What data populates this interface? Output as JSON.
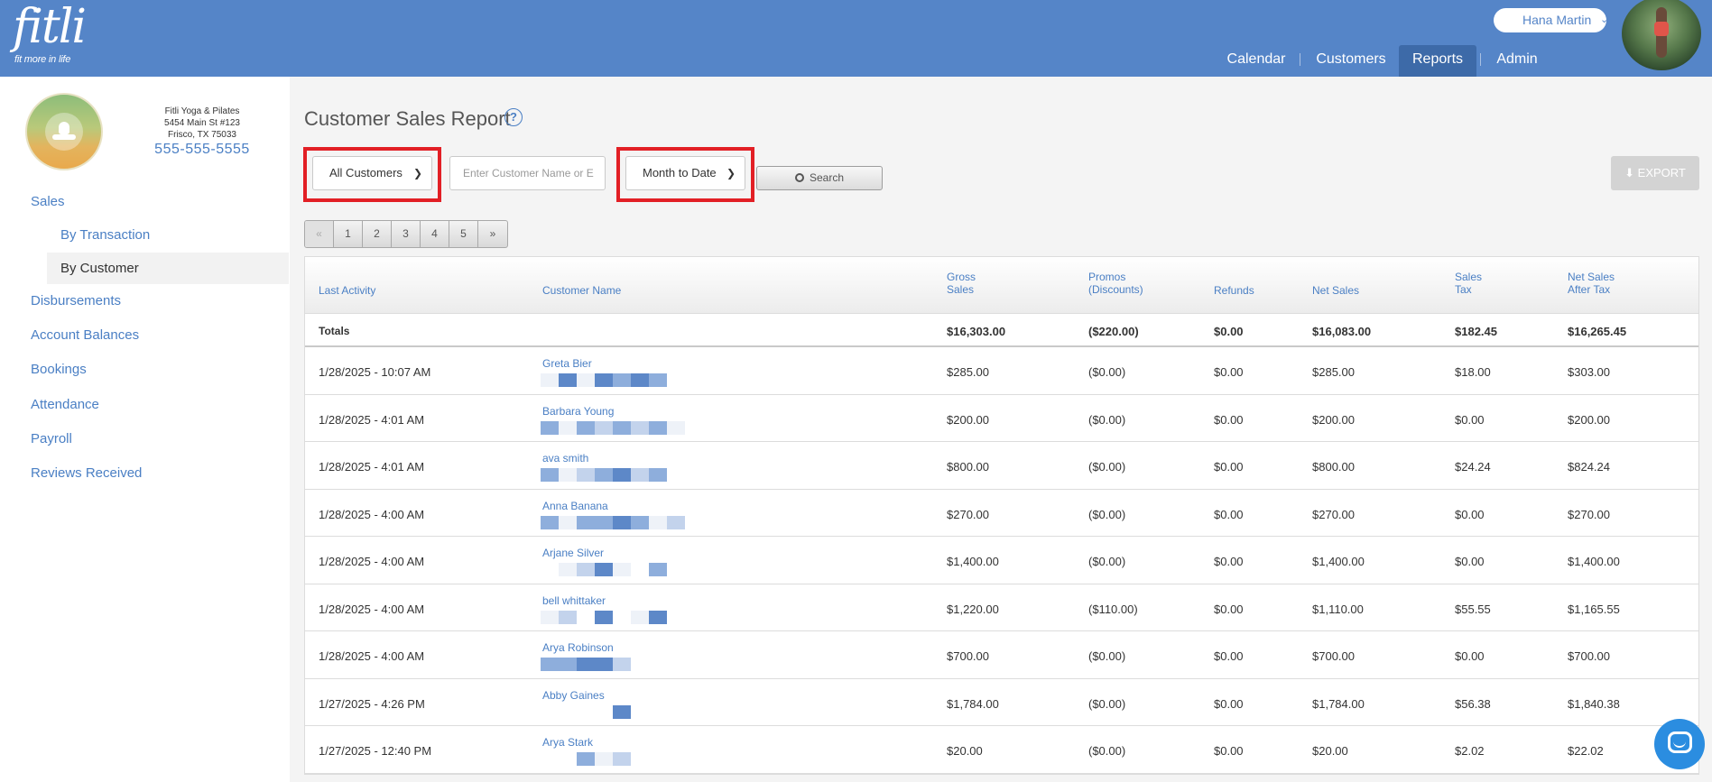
{
  "brand": {
    "name": "fitli",
    "tagline": "fit more in life"
  },
  "user": {
    "name": "Hana Martin"
  },
  "nav": {
    "calendar": "Calendar",
    "customers": "Customers",
    "reports": "Reports",
    "admin": "Admin"
  },
  "studio": {
    "name": "Fitli Yoga & Pilates",
    "address1": "5454 Main St #123",
    "address2": "Frisco, TX 75033",
    "phone": "555-555-5555"
  },
  "sidebar": {
    "sales": "Sales",
    "by_transaction": "By Transaction",
    "by_customer": "By Customer",
    "disbursements": "Disbursements",
    "account_balances": "Account Balances",
    "bookings": "Bookings",
    "attendance": "Attendance",
    "payroll": "Payroll",
    "reviews": "Reviews Received"
  },
  "report": {
    "title": "Customer Sales Report",
    "customer_filter": "All Customers",
    "search_placeholder": "Enter Customer Name or E",
    "date_filter": "Month to Date",
    "search_label": "Search",
    "export_label": "EXPORT",
    "pages": [
      "«",
      "1",
      "2",
      "3",
      "4",
      "5",
      "»"
    ]
  },
  "table": {
    "headers": {
      "last_activity": "Last Activity",
      "customer_name": "Customer Name",
      "gross_1": "Gross",
      "gross_2": "Sales",
      "promos_1": "Promos",
      "promos_2": "(Discounts)",
      "refunds": "Refunds",
      "net_sales": "Net Sales",
      "tax_1": "Sales",
      "tax_2": "Tax",
      "net_after_1": "Net Sales",
      "net_after_2": "After Tax"
    },
    "totals": {
      "label": "Totals",
      "gross": "$16,303.00",
      "promos": "($220.00)",
      "refunds": "$0.00",
      "net": "$16,083.00",
      "tax": "$182.45",
      "net_after": "$16,265.45"
    },
    "rows": [
      {
        "date": "1/28/2025 - 10:07 AM",
        "name": "Greta Bier",
        "gross": "$285.00",
        "promos": "($0.00)",
        "refunds": "$0.00",
        "net": "$285.00",
        "tax": "$18.00",
        "net_after": "$303.00"
      },
      {
        "date": "1/28/2025 - 4:01 AM",
        "name": "Barbara Young",
        "gross": "$200.00",
        "promos": "($0.00)",
        "refunds": "$0.00",
        "net": "$200.00",
        "tax": "$0.00",
        "net_after": "$200.00"
      },
      {
        "date": "1/28/2025 - 4:01 AM",
        "name": "ava smith",
        "gross": "$800.00",
        "promos": "($0.00)",
        "refunds": "$0.00",
        "net": "$800.00",
        "tax": "$24.24",
        "net_after": "$824.24"
      },
      {
        "date": "1/28/2025 - 4:00 AM",
        "name": "Anna Banana",
        "gross": "$270.00",
        "promos": "($0.00)",
        "refunds": "$0.00",
        "net": "$270.00",
        "tax": "$0.00",
        "net_after": "$270.00"
      },
      {
        "date": "1/28/2025 - 4:00 AM",
        "name": "Arjane Silver",
        "gross": "$1,400.00",
        "promos": "($0.00)",
        "refunds": "$0.00",
        "net": "$1,400.00",
        "tax": "$0.00",
        "net_after": "$1,400.00"
      },
      {
        "date": "1/28/2025 - 4:00 AM",
        "name": "bell whittaker",
        "gross": "$1,220.00",
        "promos": "($110.00)",
        "refunds": "$0.00",
        "net": "$1,110.00",
        "tax": "$55.55",
        "net_after": "$1,165.55"
      },
      {
        "date": "1/28/2025 - 4:00 AM",
        "name": "Arya Robinson",
        "gross": "$700.00",
        "promos": "($0.00)",
        "refunds": "$0.00",
        "net": "$700.00",
        "tax": "$0.00",
        "net_after": "$700.00"
      },
      {
        "date": "1/27/2025 - 4:26 PM",
        "name": "Abby Gaines",
        "gross": "$1,784.00",
        "promos": "($0.00)",
        "refunds": "$0.00",
        "net": "$1,784.00",
        "tax": "$56.38",
        "net_after": "$1,840.38"
      },
      {
        "date": "1/27/2025 - 12:40 PM",
        "name": "Arya Stark",
        "gross": "$20.00",
        "promos": "($0.00)",
        "refunds": "$0.00",
        "net": "$20.00",
        "tax": "$2.02",
        "net_after": "$22.02"
      }
    ]
  }
}
